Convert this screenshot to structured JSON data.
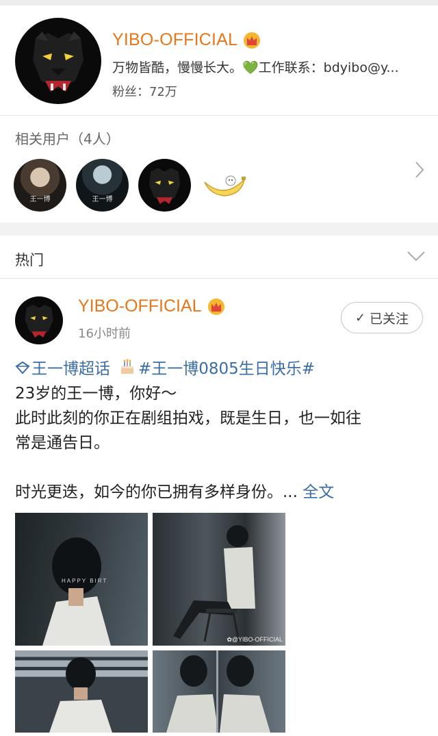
{
  "profile": {
    "name": "YIBO-OFFICIAL",
    "bio": "万物皆酷，慢慢长大。💚工作联系：bdyibo@y...",
    "fans": "粉丝：72万"
  },
  "related": {
    "title": "相关用户（4人）",
    "users": [
      {
        "avatar_text": "王一博"
      },
      {
        "avatar_text": "王一博"
      },
      {
        "avatar_text": ""
      },
      {
        "avatar_text": ""
      }
    ]
  },
  "hot": {
    "title": "热门"
  },
  "post": {
    "author": "YIBO-OFFICIAL",
    "time": "16小时前",
    "follow_label": "已关注",
    "topic": "王一博超话",
    "hashtag": "#王一博0805生日快乐#",
    "line1": "23岁的王一博，你好～",
    "line2": "此时此刻的你正在剧组拍戏，既是生日，也一如往",
    "line3": "常是通告日。",
    "line4": "时光更迭，如今的你已拥有多样身份。...",
    "full_text": "全文",
    "photos": [
      {
        "caption": ""
      },
      {
        "caption": "✿@YIBO-OFFICIAL"
      },
      {
        "caption": ""
      },
      {
        "caption": ""
      }
    ]
  },
  "colors": {
    "name": "#e8761a",
    "link": "#3a6ea5",
    "heart": "#3cba54"
  }
}
